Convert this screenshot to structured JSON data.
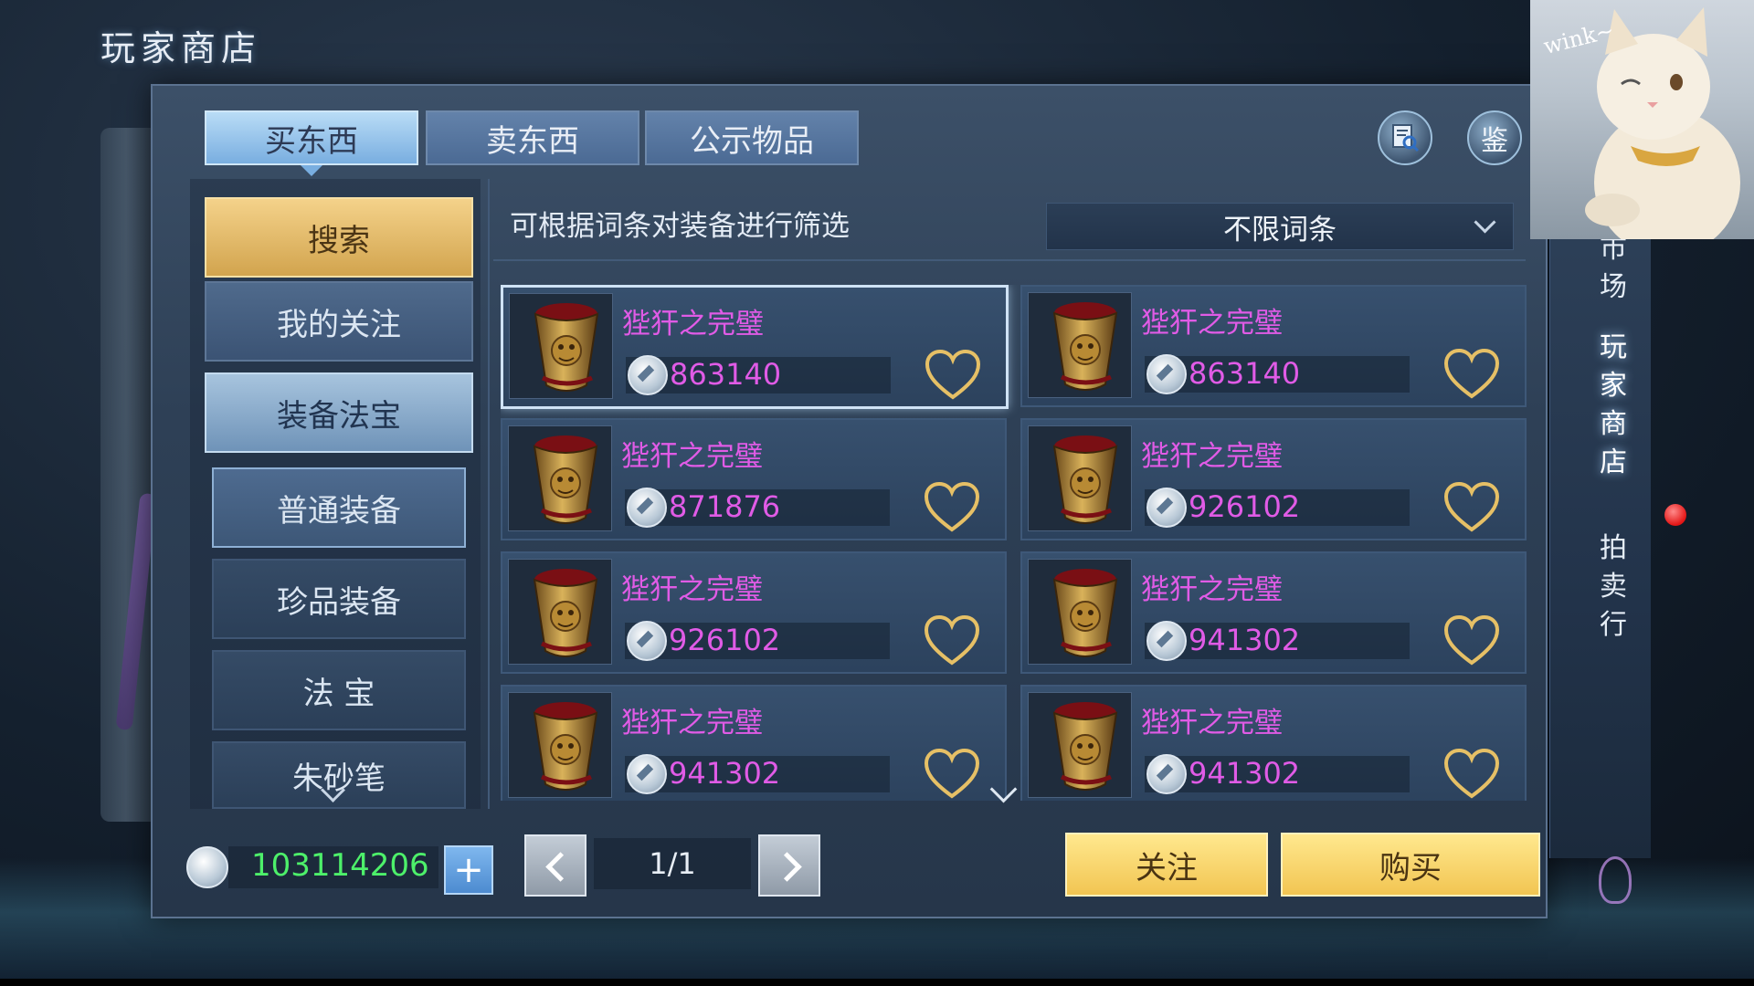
{
  "screen_title": "玩家商店",
  "tabs": [
    {
      "label": "买东西",
      "active": true
    },
    {
      "label": "卖东西",
      "active": false
    },
    {
      "label": "公示物品",
      "active": false
    }
  ],
  "top_buttons": {
    "inspect_label": "鉴"
  },
  "sidebar": {
    "search_label": "搜索",
    "favorites_label": "我的关注",
    "equipment_label": "装备法宝",
    "sub_items": [
      {
        "label": "普通装备",
        "selected": true
      },
      {
        "label": "珍品装备",
        "selected": false
      },
      {
        "label": "法 宝",
        "selected": false
      },
      {
        "label": "朱砂笔",
        "selected": false
      }
    ]
  },
  "filter": {
    "label": "可根据词条对装备进行筛选",
    "selected": "不限词条"
  },
  "items": [
    {
      "name": "狴犴之完璧",
      "price": "863140",
      "selected": true
    },
    {
      "name": "狴犴之完璧",
      "price": "863140",
      "selected": false
    },
    {
      "name": "狴犴之完璧",
      "price": "871876",
      "selected": false
    },
    {
      "name": "狴犴之完璧",
      "price": "926102",
      "selected": false
    },
    {
      "name": "狴犴之完璧",
      "price": "926102",
      "selected": false
    },
    {
      "name": "狴犴之完璧",
      "price": "941302",
      "selected": false
    },
    {
      "name": "狴犴之完璧",
      "price": "941302",
      "selected": false
    },
    {
      "name": "狴犴之完璧",
      "price": "941302",
      "selected": false
    }
  ],
  "wallet": {
    "amount": "103114206",
    "plus_label": "+"
  },
  "pagination": {
    "text": "1/1"
  },
  "actions": {
    "follow_label": "关注",
    "buy_label": "购买"
  },
  "right_nav": [
    {
      "label": "市场",
      "active": false
    },
    {
      "label": "玩家商店",
      "active": true
    },
    {
      "label": "拍卖行",
      "active": false
    }
  ],
  "cam_overlay": {
    "text": "wink~"
  },
  "colors": {
    "item_name": "#e05be6",
    "wallet_amount": "#4df06a",
    "gold_button": "#f2c552",
    "active_tab": "#79aee0"
  }
}
